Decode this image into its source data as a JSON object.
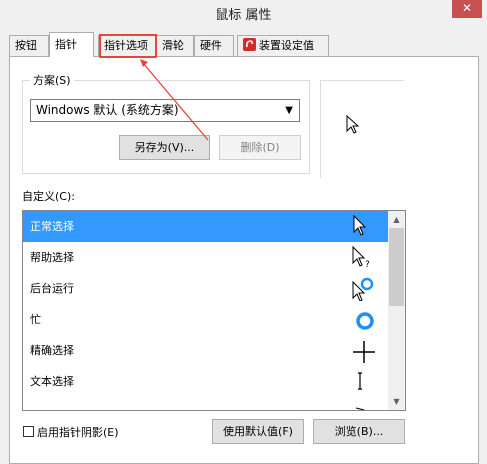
{
  "window": {
    "title": "鼠标 属性",
    "close_label": "✕"
  },
  "tabs": [
    {
      "label": "按钮"
    },
    {
      "label": "指针"
    },
    {
      "label": "指针选项"
    },
    {
      "label": "滑轮"
    },
    {
      "label": "硬件"
    },
    {
      "label": "装置设定值"
    }
  ],
  "scheme": {
    "group_label": "方案(S)",
    "selected": "Windows 默认 (系统方案)",
    "save_as_label": "另存为(V)...",
    "delete_label": "删除(D)"
  },
  "customize": {
    "label": "自定义(C):",
    "items": [
      {
        "label": "正常选择",
        "icon": "arrow-cursor-icon",
        "selected": true
      },
      {
        "label": "帮助选择",
        "icon": "help-cursor-icon",
        "selected": false
      },
      {
        "label": "后台运行",
        "icon": "working-in-background-cursor-icon",
        "selected": false
      },
      {
        "label": "忙",
        "icon": "busy-cursor-icon",
        "selected": false
      },
      {
        "label": "精确选择",
        "icon": "crosshair-cursor-icon",
        "selected": false
      },
      {
        "label": "文本选择",
        "icon": "text-beam-cursor-icon",
        "selected": false
      }
    ]
  },
  "footer": {
    "shadow_label": "启用指针阴影(E)",
    "shadow_checked": false,
    "use_default_label": "使用默认值(F)",
    "browse_label": "浏览(B)..."
  },
  "colors": {
    "selection": "#3399ff",
    "annotation": "#e8453c",
    "close": "#c75050"
  }
}
